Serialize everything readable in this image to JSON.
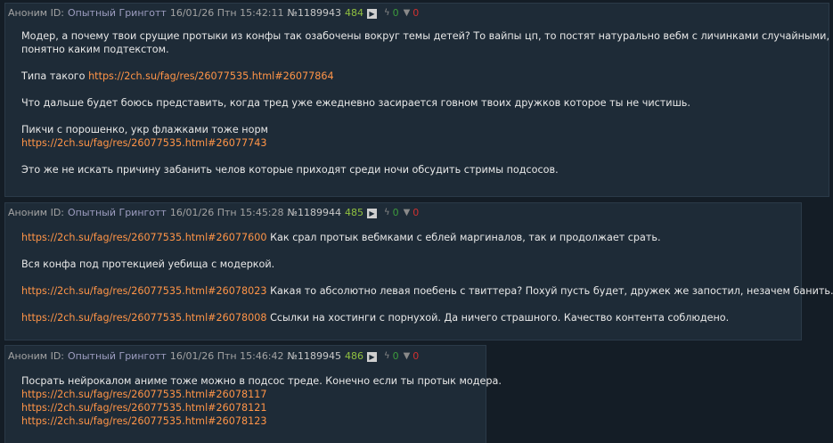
{
  "posts": [
    {
      "author_label": "Аноним ID:",
      "author_name": "Опытный Гринготт",
      "date": "16/01/26 Птн 15:42:11",
      "number": "№1189943",
      "reply_count": "484",
      "likes": "0",
      "dislikes": "0",
      "lines": [
        "Модер, а почему твои срущие протыки из конфы так озабочены вокруг темы детей? То вайпы цп, то постят натурально вебм с личинками случайными, с",
        "понятно каким подтекстом.",
        "Типа такого",
        "https://2ch.su/fag/res/26077535.html#26077864",
        "Что дальше будет боюсь представить, когда тред уже ежедневно засирается говном твоих дружков которое ты не чистишь.",
        "Пикчи с порошенко, укр флажками тоже норм",
        "https://2ch.su/fag/res/26077535.html#26077743",
        "Это же не искать причину забанить челов которые приходят среди ночи обсудить стримы подсосов."
      ]
    },
    {
      "author_label": "Аноним ID:",
      "author_name": "Опытный Гринготт",
      "date": "16/01/26 Птн 15:45:28",
      "number": "№1189944",
      "reply_count": "485",
      "likes": "0",
      "dislikes": "0",
      "lines": [
        "https://2ch.su/fag/res/26077535.html#26077600",
        "Как срал протык вебмками с еблей маргиналов, так и продолжает срать.",
        "Вся конфа под протекцией уебища с модеркой.",
        "https://2ch.su/fag/res/26077535.html#26078023",
        "Какая то абсолютно левая поебень с твиттера? Похуй пусть будет, дружек же запостил, незачем банить.",
        "https://2ch.su/fag/res/26077535.html#26078008",
        "Ссылки на хостинги с порнухой. Да ничего страшного. Качество контента соблюдено."
      ]
    },
    {
      "author_label": "Аноним ID:",
      "author_name": "Опытный Гринготт",
      "date": "16/01/26 Птн 15:46:42",
      "number": "№1189945",
      "reply_count": "486",
      "likes": "0",
      "dislikes": "0",
      "lines": [
        "Посрать нейрокалом аниме тоже можно в подсос треде. Конечно если ты протык модера.",
        "https://2ch.su/fag/res/26077535.html#26078117",
        "https://2ch.su/fag/res/26077535.html#26078121",
        "https://2ch.su/fag/res/26077535.html#26078123"
      ]
    }
  ],
  "colors": {
    "background": "#141d26",
    "post_bg": "#1e2b37",
    "link": "#ff9447",
    "name": "#9d9dc0",
    "reply_count": "#90c040",
    "like": "#3c9a3c",
    "dislike": "#d03030"
  },
  "icons": {
    "play": "play-icon",
    "like": "lightning-icon",
    "dislike": "thumbs-down-icon"
  }
}
